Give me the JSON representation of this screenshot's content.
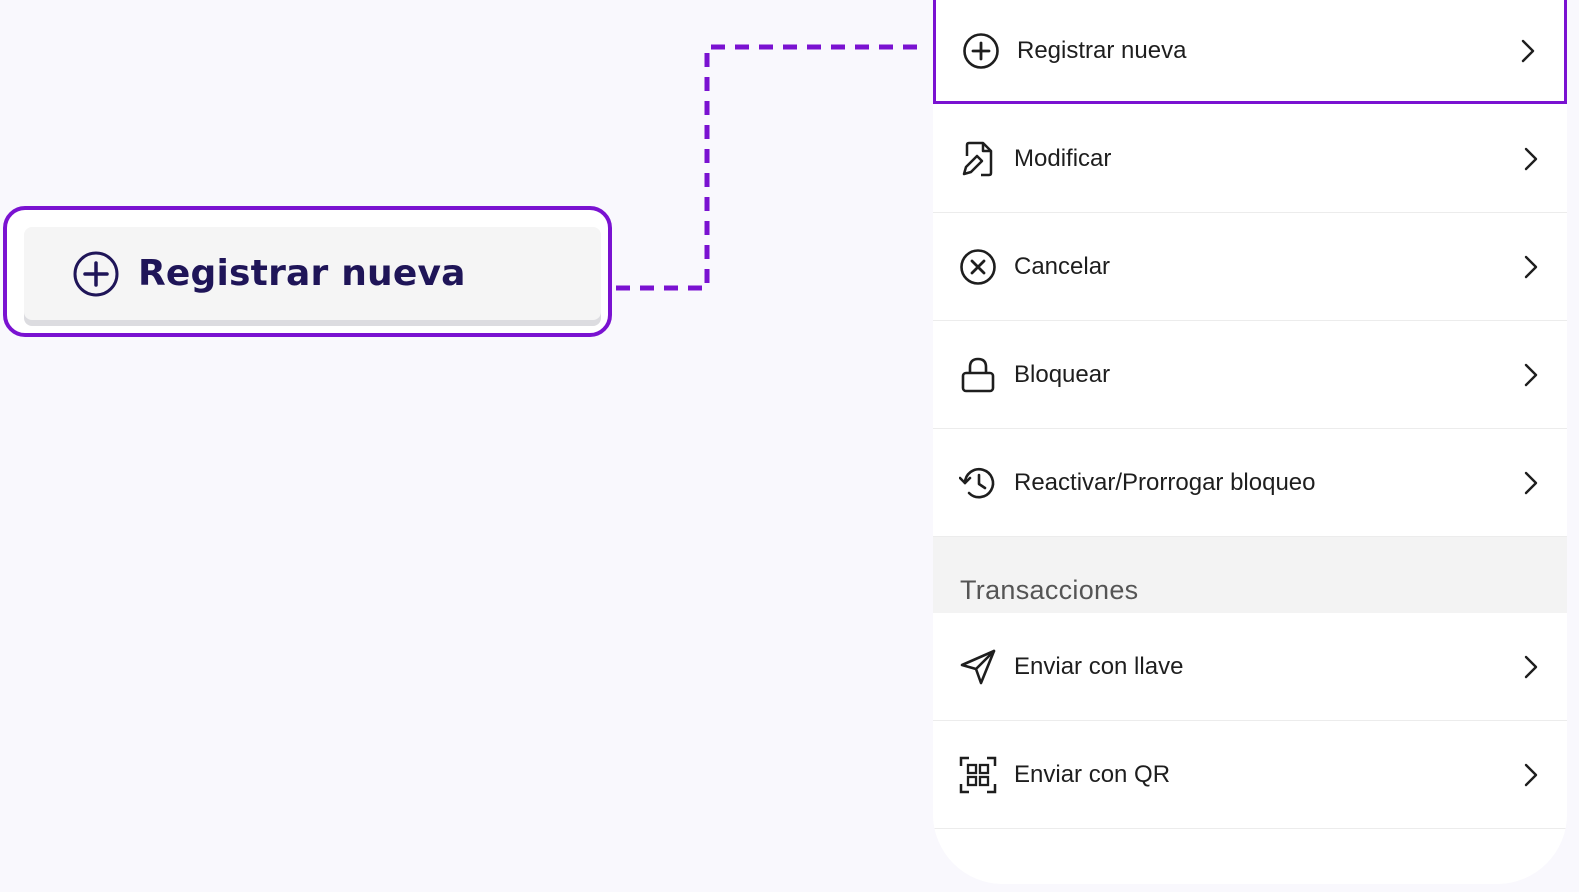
{
  "callout": {
    "label": "Registrar nueva",
    "icon": "plus-circle-icon"
  },
  "colors": {
    "accent": "#7a12d1",
    "callout_text": "#1f1558",
    "background": "#f9f8fd"
  },
  "menu": {
    "items": [
      {
        "label": "Registrar nueva",
        "icon": "plus-circle-icon"
      },
      {
        "label": "Modificar",
        "icon": "edit-document-icon"
      },
      {
        "label": "Cancelar",
        "icon": "x-circle-icon"
      },
      {
        "label": "Bloquear",
        "icon": "lock-icon"
      },
      {
        "label": "Reactivar/Prorrogar bloqueo",
        "icon": "history-icon"
      }
    ]
  },
  "transactions": {
    "title": "Transacciones",
    "items": [
      {
        "label": "Enviar con llave",
        "icon": "send-icon"
      },
      {
        "label": "Enviar con QR",
        "icon": "qr-code-icon"
      }
    ]
  }
}
